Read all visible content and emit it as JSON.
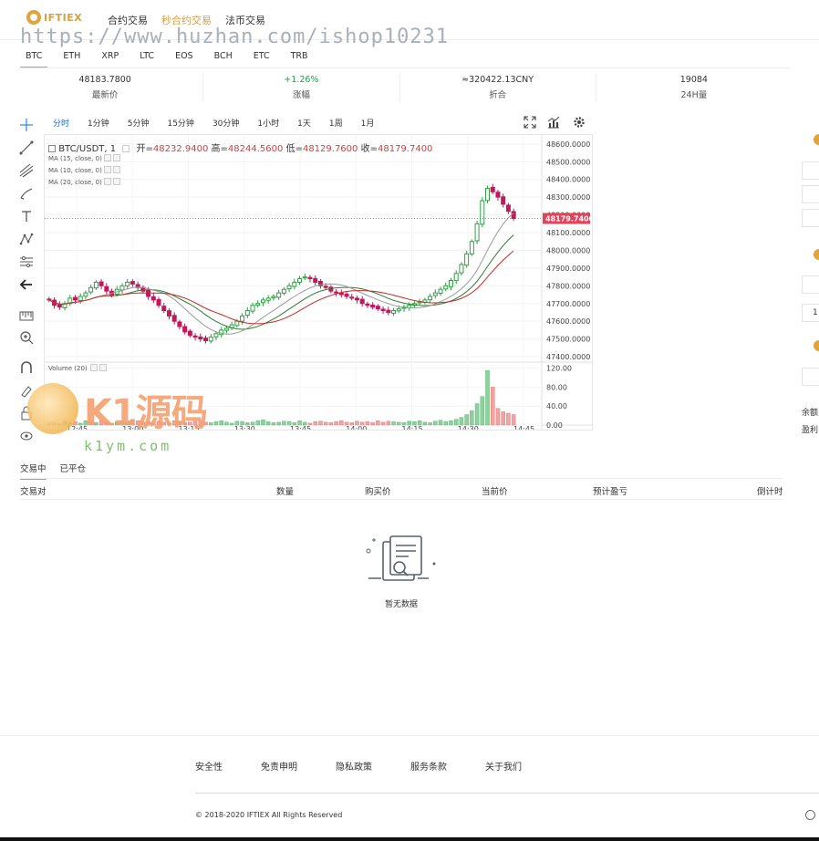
{
  "header": {
    "logo_text": "IFTIEX",
    "nav": [
      {
        "label": "合约交易",
        "active": false
      },
      {
        "label": "秒合约交易",
        "active": true
      },
      {
        "label": "法币交易",
        "active": false
      }
    ],
    "watermark": "https://www.huzhan.com/ishop10231"
  },
  "coins": [
    "BTC",
    "ETH",
    "XRP",
    "LTC",
    "EOS",
    "BCH",
    "ETC",
    "TRB"
  ],
  "active_coin": "BTC",
  "stats": [
    {
      "value": "48183.7800",
      "label": "最新价",
      "color": "#333333"
    },
    {
      "value": "+1.26%",
      "label": "涨幅",
      "color": "#17a54a"
    },
    {
      "value": "≈320422.13CNY",
      "label": "折合",
      "color": "#333333"
    },
    {
      "value": "19084",
      "label": "24H量",
      "color": "#333333"
    }
  ],
  "chart_toolbar": {
    "intervals": [
      "分时",
      "1分钟",
      "5分钟",
      "15分钟",
      "30分钟",
      "1小时",
      "1天",
      "1周",
      "1月"
    ],
    "active_interval": "分时",
    "icons": [
      "fullscreen-icon",
      "indicators-icon",
      "settings-icon"
    ]
  },
  "left_tools": [
    "crosshair-icon",
    "trendline-icon",
    "pitchfork-icon",
    "brush-icon",
    "text-icon",
    "pattern-icon",
    "measure-icon",
    "back-arrow-icon",
    "ruler-icon",
    "zoom-in-icon",
    "magnet-icon",
    "lock-drawing-icon",
    "lock-icon",
    "eye-icon"
  ],
  "legend": {
    "symbol": "BTC/USDT, 1",
    "open_label": "开",
    "open": "48232.9400",
    "high_label": "高",
    "high": "48244.5600",
    "low_label": "低",
    "low": "48129.7600",
    "close_label": "收",
    "close": "48179.7400",
    "ma": [
      "MA (15, close, 0)",
      "MA (10, close, 0)",
      "MA (20, close, 0)"
    ],
    "volume": "Volume (20)"
  },
  "chart_data": {
    "type": "candlestick",
    "price_axis": [
      "48600.0000",
      "48500.0000",
      "48400.0000",
      "48300.0000",
      "48200.0000",
      "48100.0000",
      "48000.0000",
      "47900.0000",
      "47800.0000",
      "47700.0000",
      "47600.0000",
      "47500.0000",
      "47400.0000"
    ],
    "ylim": [
      47390,
      48630
    ],
    "last_price_label": "48179.7400",
    "last_price": 48179.74,
    "volume_axis": [
      "120.00",
      "80.00",
      "40.00",
      "0.00"
    ],
    "volume_lim": [
      0,
      125
    ],
    "time_axis": [
      "12:45",
      "13:00",
      "13:15",
      "13:30",
      "13:45",
      "14:00",
      "14:15",
      "14:30",
      "14:45"
    ],
    "close_path": [
      47720,
      47690,
      47680,
      47700,
      47730,
      47720,
      47740,
      47760,
      47790,
      47820,
      47800,
      47770,
      47750,
      47780,
      47800,
      47820,
      47810,
      47790,
      47770,
      47740,
      47720,
      47690,
      47660,
      47630,
      47600,
      47570,
      47540,
      47520,
      47510,
      47500,
      47490,
      47510,
      47530,
      47550,
      47560,
      47580,
      47600,
      47630,
      47660,
      47690,
      47700,
      47720,
      47730,
      47740,
      47760,
      47780,
      47800,
      47820,
      47840,
      47850,
      47840,
      47820,
      47800,
      47790,
      47770,
      47760,
      47750,
      47740,
      47730,
      47720,
      47700,
      47690,
      47680,
      47670,
      47660,
      47650,
      47660,
      47670,
      47680,
      47690,
      47700,
      47710,
      47720,
      47740,
      47760,
      47780,
      47800,
      47830,
      47870,
      47920,
      47980,
      48050,
      48150,
      48280,
      48350,
      48330,
      48300,
      48260,
      48220,
      48179.74
    ],
    "volumes": [
      4,
      6,
      3,
      8,
      5,
      7,
      4,
      9,
      6,
      5,
      10,
      7,
      4,
      6,
      8,
      5,
      12,
      9,
      6,
      7,
      5,
      8,
      6,
      4,
      9,
      7,
      5,
      6,
      8,
      10,
      6,
      5,
      7,
      9,
      6,
      4,
      8,
      7,
      5,
      6,
      9,
      11,
      7,
      5,
      6,
      8,
      7,
      5,
      9,
      6,
      4,
      7,
      8,
      6,
      5,
      7,
      9,
      6,
      5,
      8,
      6,
      7,
      5,
      9,
      6,
      8,
      7,
      6,
      5,
      8,
      7,
      9,
      6,
      5,
      8,
      10,
      7,
      9,
      12,
      16,
      22,
      30,
      45,
      60,
      115,
      80,
      35,
      28,
      25,
      22
    ],
    "series": [
      {
        "name": "MA (15, close, 0)",
        "color": "#2e7d32"
      },
      {
        "name": "MA (10, close, 0)",
        "color": "#999999"
      },
      {
        "name": "MA (20, close, 0)",
        "color": "#c62828"
      }
    ],
    "up_color": "#2ea043",
    "down_color": "#c2185b"
  },
  "positions": {
    "tabs": [
      "交易中",
      "已平仓"
    ],
    "active_tab": "交易中",
    "columns": [
      "交易对",
      "数量",
      "购买价",
      "当前价",
      "预计盈亏",
      "倒计时"
    ],
    "empty_text": "暂无数据"
  },
  "right_panel": {
    "balance_label": "余额",
    "profit_label": "盈利",
    "field_value": "1"
  },
  "overlay": {
    "brand": "K1源码",
    "url": "k1ym.com"
  },
  "footer": {
    "links": [
      "安全性",
      "免责申明",
      "隐私政策",
      "服务条款",
      "关于我们"
    ],
    "copyright": "© 2018-2020 IFTIEX All Rights Reserved"
  }
}
